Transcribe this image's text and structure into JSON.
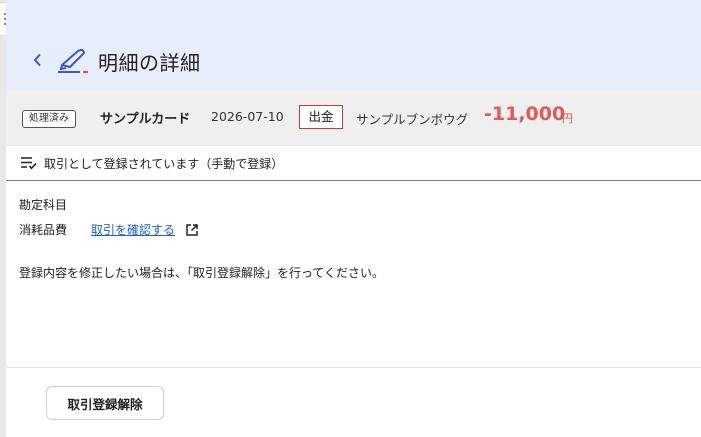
{
  "header": {
    "title": "明細の詳細"
  },
  "summary": {
    "status": "処理済み",
    "card_name": "サンプルカード",
    "date": "2026-07-10",
    "type": "出金",
    "payee": "サンプルブンボウグ",
    "amount": "-11,000",
    "currency": "円"
  },
  "registration": {
    "message": "取引として登録されています（手動で登録）"
  },
  "details": {
    "account_label": "勘定科目",
    "account_value": "消耗品費",
    "confirm_link": "取引を確認する",
    "instruction": "登録内容を修正したい場合は、「取引登録解除」を行ってください。"
  },
  "footer": {
    "unregister_button": "取引登録解除"
  },
  "colors": {
    "header_bg": "#e6eefb",
    "summary_bg": "#efefef",
    "amount": "#e05a5a",
    "link": "#1f5fc4",
    "badge_border": "#d33",
    "accent_icon": "#3a56c9"
  }
}
